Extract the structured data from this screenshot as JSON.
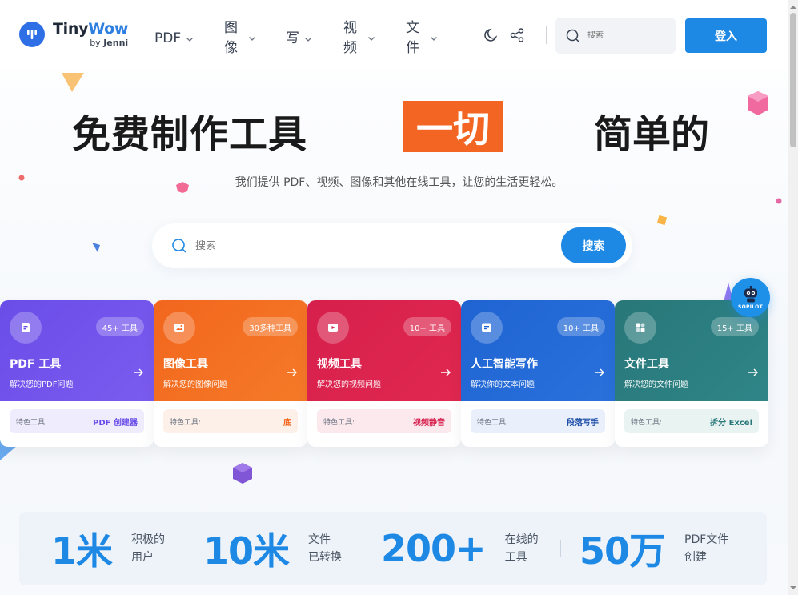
{
  "brand": {
    "title_a": "Tiny",
    "title_b": "Wow",
    "by": "by",
    "author": "Jenni"
  },
  "nav": {
    "items": [
      {
        "label": "PDF"
      },
      {
        "label": "图像"
      },
      {
        "label": "写"
      },
      {
        "label": "视频"
      },
      {
        "label": "文件"
      }
    ]
  },
  "header": {
    "search_placeholder": "搜索",
    "login_label": "登入"
  },
  "hero": {
    "title_a": "免费制作工具",
    "title_highlight": "一切",
    "title_c": "简单的",
    "subtitle": "我们提供 PDF、视频、图像和其他在线工具，让您的生活更轻松。",
    "search_placeholder": "搜索",
    "search_button": "搜索"
  },
  "cards": [
    {
      "title": "PDF 工具",
      "desc": "解决您的PDF问题",
      "badge": "45+ 工具",
      "feat_label": "特色工具:",
      "feat_value": "PDF 创建器",
      "color": "#6a4de8",
      "color2": "#7b5cf0",
      "feat_bg": "#efecfd",
      "feat_color": "#6a4de8"
    },
    {
      "title": "图像工具",
      "desc": "解决您的图像问题",
      "badge": "30多种工具",
      "feat_label": "特色工具:",
      "feat_value": "底",
      "color": "#f2661d",
      "color2": "#f57a28",
      "feat_bg": "#fdf0e8",
      "feat_color": "#f2661d"
    },
    {
      "title": "视频工具",
      "desc": "解决您的视频问题",
      "badge": "10+ 工具",
      "feat_label": "特色工具:",
      "feat_value": "视频静音",
      "color": "#d61f4c",
      "color2": "#e0284f",
      "feat_bg": "#fbe9ee",
      "feat_color": "#d61f4c"
    },
    {
      "title": "人工智能写作",
      "desc": "解决你的文本问题",
      "badge": "10+ 工具",
      "feat_label": "特色工具:",
      "feat_value": "段落写手",
      "color": "#1f64d2",
      "color2": "#2a71dc",
      "feat_bg": "#e9f0fb",
      "feat_color": "#1f4fa8"
    },
    {
      "title": "文件工具",
      "desc": "解决您的文件问题",
      "badge": "15+ 工具",
      "feat_label": "特色工具:",
      "feat_value": "拆分 Excel",
      "color": "#287779",
      "color2": "#2f8587",
      "feat_bg": "#e8f3f2",
      "feat_color": "#287779"
    }
  ],
  "assistant": {
    "label": "SOPILOT"
  },
  "stats": [
    {
      "number": "1米",
      "label_1": "积极的",
      "label_2": "用户"
    },
    {
      "number": "10米",
      "label_1": "文件",
      "label_2": "已转换"
    },
    {
      "number": "200+",
      "label_1": "在线的",
      "label_2": "工具"
    },
    {
      "number": "50万",
      "label_1": "PDF文件",
      "label_2": "创建"
    }
  ],
  "colors": {
    "accent": "#1e88e5",
    "highlight": "#f26522"
  }
}
